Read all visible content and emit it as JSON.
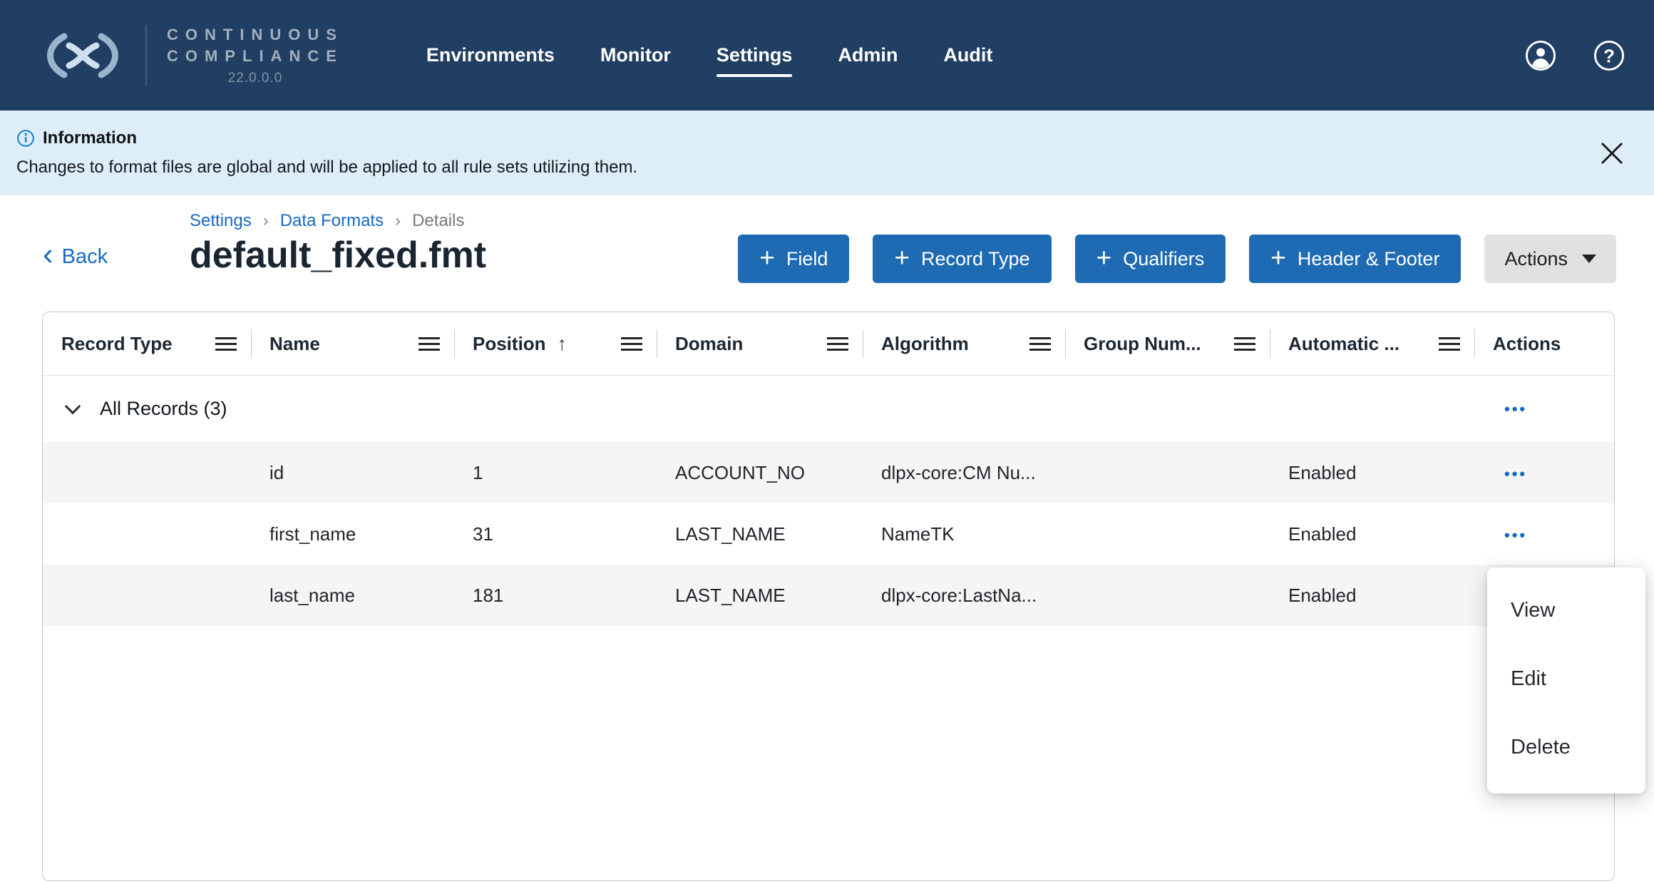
{
  "navbar": {
    "brand_line1": "CONTINUOUS",
    "brand_line2": "COMPLIANCE",
    "version": "22.0.0.0",
    "items": [
      {
        "label": "Environments",
        "active": false
      },
      {
        "label": "Monitor",
        "active": false
      },
      {
        "label": "Settings",
        "active": true
      },
      {
        "label": "Admin",
        "active": false
      },
      {
        "label": "Audit",
        "active": false
      }
    ]
  },
  "banner": {
    "title": "Information",
    "message": "Changes to format files are global and will be applied to all rule sets utilizing them."
  },
  "breadcrumb": {
    "links": [
      "Settings",
      "Data Formats"
    ],
    "current": "Details"
  },
  "page_header": {
    "back_label": "Back",
    "title": "default_fixed.fmt",
    "add_buttons": [
      {
        "label": "Field"
      },
      {
        "label": "Record Type"
      },
      {
        "label": "Qualifiers"
      },
      {
        "label": "Header & Footer"
      }
    ],
    "actions_label": "Actions"
  },
  "table": {
    "columns": [
      {
        "label": "Record Type"
      },
      {
        "label": "Name"
      },
      {
        "label": "Position",
        "sorted": "ascending"
      },
      {
        "label": "Domain"
      },
      {
        "label": "Algorithm"
      },
      {
        "label": "Group Num..."
      },
      {
        "label": "Automatic ..."
      },
      {
        "label": "Actions"
      }
    ],
    "group_row": {
      "label": "All Records (3)"
    },
    "rows": [
      {
        "record_type": "",
        "name": "id",
        "position": "1",
        "domain": "ACCOUNT_NO",
        "algorithm": "dlpx-core:CM Nu...",
        "group_number": "",
        "automatic": "Enabled"
      },
      {
        "record_type": "",
        "name": "first_name",
        "position": "31",
        "domain": "LAST_NAME",
        "algorithm": "NameTK",
        "group_number": "",
        "automatic": "Enabled"
      },
      {
        "record_type": "",
        "name": "last_name",
        "position": "181",
        "domain": "LAST_NAME",
        "algorithm": "dlpx-core:LastNa...",
        "group_number": "",
        "automatic": "Enabled"
      }
    ]
  },
  "context_menu": {
    "items": [
      "View",
      "Edit",
      "Delete"
    ]
  },
  "icons": {
    "plus": "+",
    "back_chevron": "‹",
    "breadcrumb_separator": "›",
    "sort_up": "↑",
    "ellipsis": "•••"
  },
  "colors": {
    "navbar_bg": "#213e63",
    "banner_bg": "#ddeef8",
    "primary_button": "#1e6ab3",
    "link_blue": "#1769c0",
    "row_alt": "#f5f5f5"
  }
}
